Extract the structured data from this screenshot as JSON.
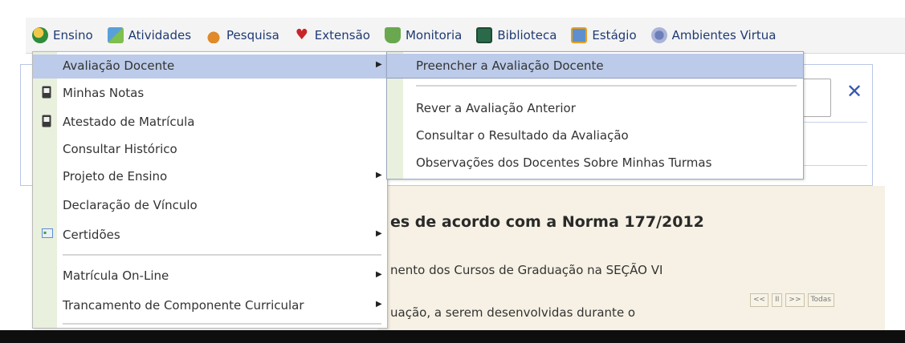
{
  "menubar": {
    "items": [
      {
        "label": "Ensino",
        "icon": "globe-icon",
        "color": "#2f8c3a"
      },
      {
        "label": "Atividades",
        "icon": "activities-icon",
        "color": "#5aa0d8"
      },
      {
        "label": "Pesquisa",
        "icon": "flask-icon",
        "color": "#e08a2a"
      },
      {
        "label": "Extensão",
        "icon": "heart-icon",
        "color": "#c8242b"
      },
      {
        "label": "Monitoria",
        "icon": "monitor-icon",
        "color": "#6aa84f"
      },
      {
        "label": "Biblioteca",
        "icon": "book-icon",
        "color": "#2a6a4a"
      },
      {
        "label": "Estágio",
        "icon": "certificate-icon",
        "color": "#e3a11f"
      },
      {
        "label": "Ambientes Virtua",
        "icon": "virtual-env-icon",
        "color": "#6d7eb8"
      }
    ]
  },
  "background": {
    "notice_title": "es de acordo com a Norma 177/2012",
    "notice_text1": "nento dos Cursos de Graduação na SEÇÃO VI",
    "notice_text2": "uação, a serem desenvolvidas durante o",
    "close_symbol": "✕",
    "pager": [
      "<<",
      "II",
      ">>",
      "Todas"
    ]
  },
  "dropdown": {
    "items": [
      {
        "label": "Avaliação Docente",
        "submenu": true,
        "active": true,
        "icon": ""
      },
      {
        "label": "Minhas Notas",
        "submenu": false,
        "icon": "document-icon"
      },
      {
        "label": "Atestado de Matrícula",
        "submenu": false,
        "icon": "document-icon"
      },
      {
        "label": "Consultar Histórico",
        "submenu": false,
        "icon": ""
      },
      {
        "label": "Projeto de Ensino",
        "submenu": true,
        "icon": ""
      },
      {
        "label": "Declaração de Vínculo",
        "submenu": false,
        "icon": ""
      },
      {
        "label": "Certidões",
        "submenu": true,
        "icon": "certificate-icon"
      },
      {
        "label": "Matrícula On-Line",
        "submenu": true,
        "icon": ""
      },
      {
        "label": "Trancamento de Componente Curricular",
        "submenu": true,
        "icon": ""
      }
    ]
  },
  "submenu": {
    "items": [
      {
        "label": "Preencher a Avaliação Docente",
        "active": true
      },
      {
        "label": "Rever a Avaliação Anterior"
      },
      {
        "label": "Consultar o Resultado da Avaliação"
      },
      {
        "label": "Observações dos Docentes Sobre Minhas Turmas"
      }
    ]
  }
}
